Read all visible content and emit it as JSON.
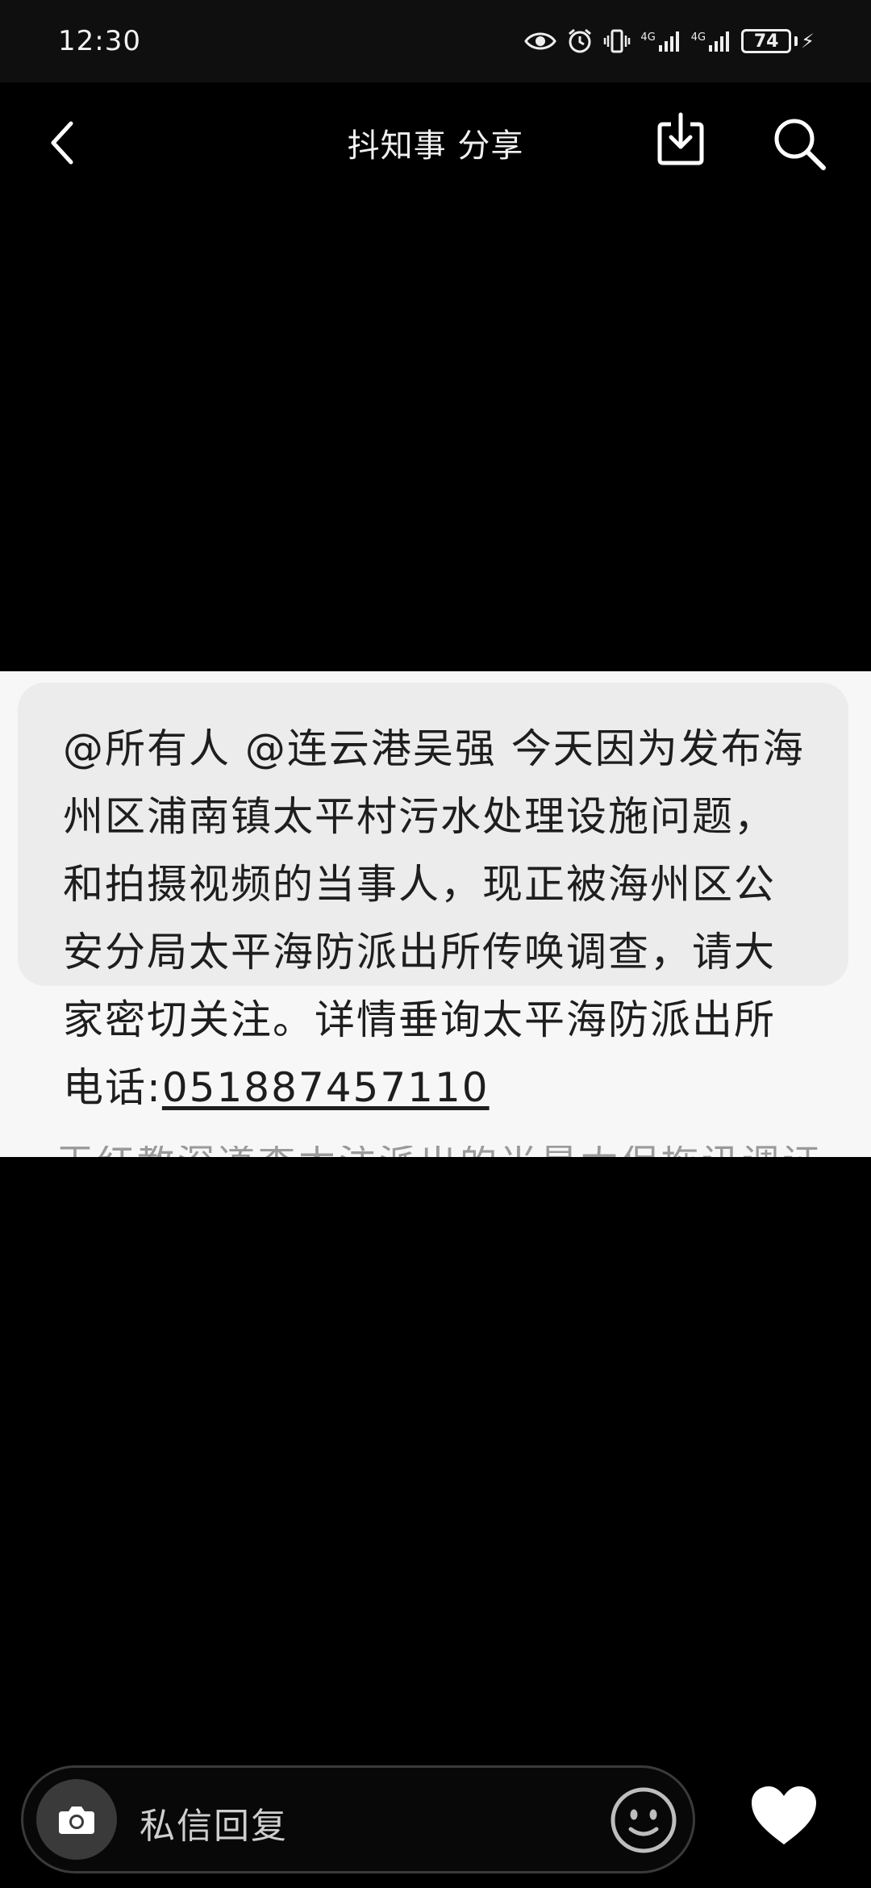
{
  "status_bar": {
    "time": "12:30",
    "network_label_1": "4G",
    "network_label_2": "4G",
    "battery_level": "74",
    "icons": [
      "eye-icon",
      "alarm-icon",
      "vibrate-icon",
      "signal-icon",
      "signal-icon",
      "battery-icon",
      "charging-icon"
    ]
  },
  "nav": {
    "title": "抖知事 分享",
    "icons": [
      "back-icon",
      "download-icon",
      "search-icon"
    ]
  },
  "message": {
    "text": "@所有人 @连云港吴强 今天因为发布海州区浦南镇太平村污水处理设施问题，和拍摄视频的当事人，现正被海州区公安分局太平海防派出所传唤调查，请大家密切关注。详情垂询太平海防派出所电话:",
    "phone": "051887457110",
    "cutoff_text": "王红教深道查木注派出的当是太保拖讯调证"
  },
  "bottom": {
    "reply_placeholder": "私信回复",
    "icons": [
      "camera-icon",
      "emoji-icon",
      "heart-icon"
    ]
  },
  "colors": {
    "background": "#000000",
    "bubble": "#ececec",
    "image_bg": "#f7f7f7",
    "camera_btn": "#3a3a3a"
  }
}
